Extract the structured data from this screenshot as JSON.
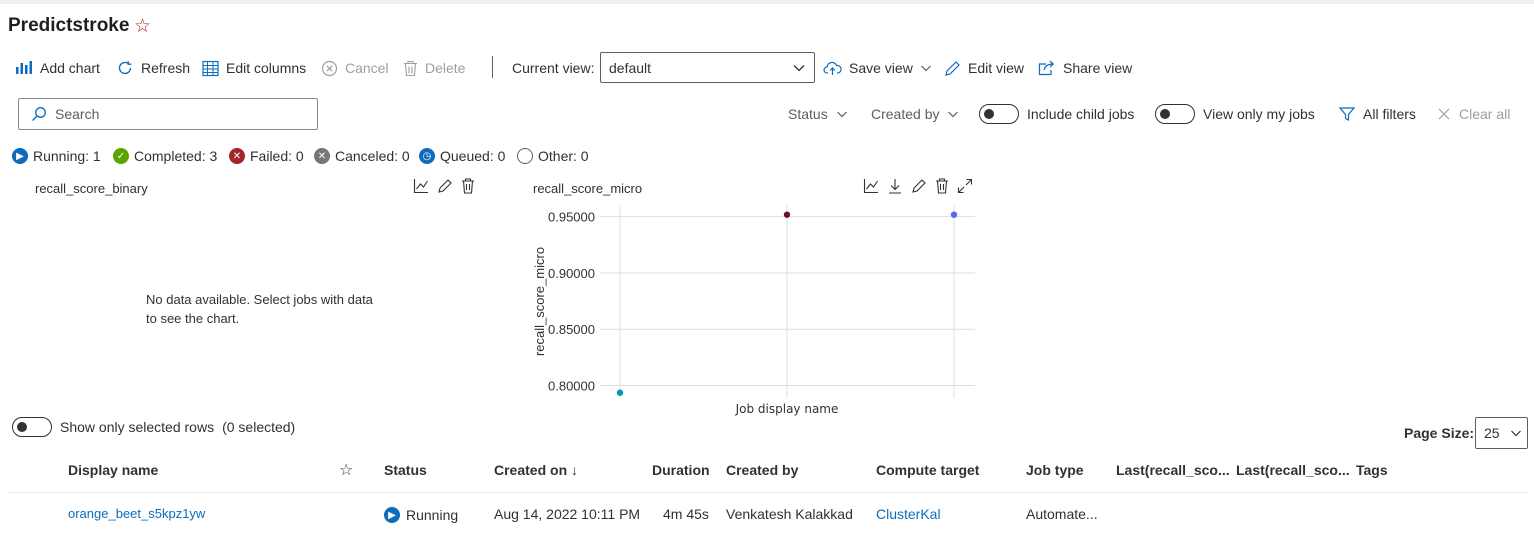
{
  "page": {
    "title": "Predictstroke"
  },
  "toolbar": {
    "add_chart": "Add chart",
    "refresh": "Refresh",
    "edit_columns": "Edit columns",
    "cancel": "Cancel",
    "delete": "Delete",
    "current_view_label": "Current view:",
    "current_view_value": "default",
    "save_view": "Save view",
    "edit_view": "Edit view",
    "share_view": "Share view"
  },
  "filters": {
    "search_placeholder": "Search",
    "status": "Status",
    "created_by": "Created by",
    "include_child_jobs": "Include child jobs",
    "view_only_my_jobs": "View only my jobs",
    "all_filters": "All filters",
    "clear_all": "Clear all"
  },
  "status_counts": [
    {
      "label": "Running: 1",
      "color": "#0f6cbd"
    },
    {
      "label": "Completed: 3",
      "color": "#57a300"
    },
    {
      "label": "Failed: 0",
      "color": "#a4262c"
    },
    {
      "label": "Canceled: 0",
      "color": "#797775"
    },
    {
      "label": "Queued: 0",
      "color": "#0f6cbd"
    },
    {
      "label": "Other: 0",
      "color": "#ffffff"
    }
  ],
  "charts": {
    "binary": {
      "title": "recall_score_binary",
      "no_data": "No data available. Select jobs with data to see the chart."
    }
  },
  "chart_data": {
    "type": "scatter",
    "title": "recall_score_micro",
    "xlabel": "Job display name",
    "ylabel": "recall_score_micro",
    "ylim": [
      0.7889,
      0.9603
    ],
    "yticks": [
      "0.95000",
      "0.90000",
      "0.85000",
      "0.80000"
    ],
    "ytick_values": [
      0.95,
      0.9,
      0.85,
      0.8
    ],
    "grid": true,
    "points": [
      {
        "x": 0,
        "y": 0.7936,
        "color": "#0099bc"
      },
      {
        "x": 1,
        "y": 0.9517,
        "color": "#6b0f3f"
      },
      {
        "x": 2,
        "y": 0.9517,
        "color": "#4f6bed"
      }
    ]
  },
  "table": {
    "show_selected_label": "Show only selected rows",
    "selected_count": "(0 selected)",
    "page_size_label": "Page Size:",
    "page_size_value": "25",
    "columns": {
      "display_name": "Display name",
      "status": "Status",
      "created_on": "Created on",
      "created_on_sort": "↓",
      "duration": "Duration",
      "created_by": "Created by",
      "compute_target": "Compute target",
      "job_type": "Job type",
      "last_recall_1": "Last(recall_sco...",
      "last_recall_2": "Last(recall_sco...",
      "tags": "Tags"
    },
    "rows": [
      {
        "display_name": "orange_beet_s5kpz1yw",
        "status": "Running",
        "created_on": "Aug 14, 2022 10:11 PM",
        "duration": "4m 45s",
        "created_by": "Venkatesh Kalakkad",
        "compute_target": "ClusterKal",
        "job_type": "Automate..."
      }
    ]
  }
}
